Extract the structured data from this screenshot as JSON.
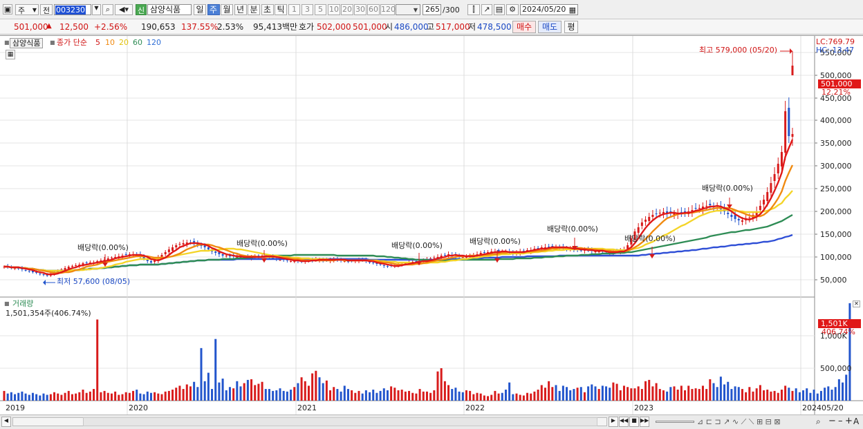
{
  "toolbar": {
    "market_label": "주",
    "prev_label": "전",
    "code": "003230",
    "stock_name": "삼양식품",
    "sin_label": "신",
    "period_buttons": [
      "일",
      "주",
      "월",
      "년",
      "분",
      "초",
      "틱"
    ],
    "interval_buttons": [
      "1",
      "3",
      "5",
      "10",
      "20",
      "30",
      "60",
      "120"
    ],
    "count": "265",
    "count_total": "/300",
    "date": "2024/05/20"
  },
  "quote": {
    "price": "501,000",
    "change": "12,500",
    "change_pct": "+2.56%",
    "volume": "190,653",
    "vol_ratio": "137.55%",
    "turnover": "2.53%",
    "amount": "95,413백만",
    "hoga_label": "호가",
    "ask": "502,000",
    "bid": "501,000",
    "open_label": "시",
    "open": "486,000",
    "high_label": "고",
    "high": "517,000",
    "low_label": "저",
    "low": "478,500",
    "buy_label": "매수",
    "sell_label": "매도",
    "avg_label": "평"
  },
  "colors": {
    "up": "#d81b1b",
    "down": "#2255cc",
    "ma5": "#e01818",
    "ma10": "#f08a10",
    "ma20": "#f4d428",
    "ma60": "#2e8c55",
    "ma120": "#2e4ed6"
  },
  "legend": {
    "name": "삼양식품",
    "prefix": "종가 단순",
    "ma5": "5",
    "ma10": "10",
    "ma20": "20",
    "ma60": "60",
    "ma120": "120"
  },
  "price_axis": {
    "lc": "LC:769.79",
    "hc": "HC:-13.47",
    "current_tag": "501,000",
    "current_pct": "12.21%"
  },
  "volume_panel": {
    "title": "거래량",
    "info": "1,501,354주(406.74%)",
    "tag": "1,501K",
    "tag_pct": "406.74%"
  },
  "annotations": {
    "max": "최고 579,000 (05/20)",
    "min": "최저 57,600 (08/05)",
    "dividend": "배당락(0.00%)"
  },
  "bottom": {
    "date_tag": "05/20"
  },
  "chart_data": {
    "type": "candlestick",
    "x_labels": [
      "2019",
      "2020",
      "2021",
      "2022",
      "2023",
      "2024"
    ],
    "price_ticks": [
      550000,
      500000,
      450000,
      400000,
      350000,
      300000,
      250000,
      200000,
      150000,
      100000,
      50000
    ],
    "price_tick_labels": [
      "550,000",
      "500,000",
      "450,000",
      "400,000",
      "350,000",
      "300,000",
      "250,000",
      "200,000",
      "150,000",
      "100,000",
      "50,000"
    ],
    "volume_ticks": [
      1000000,
      500000
    ],
    "volume_tick_labels": [
      "1,000K",
      "500,000"
    ],
    "close": [
      78000,
      77000,
      76000,
      75000,
      74000,
      72000,
      70000,
      68000,
      66000,
      64000,
      62000,
      60000,
      58500,
      62000,
      66000,
      69000,
      72000,
      75000,
      78000,
      80000,
      81000,
      83000,
      85000,
      86000,
      87000,
      88000,
      90000,
      92000,
      94000,
      96000,
      98000,
      100000,
      101000,
      103000,
      104000,
      105000,
      106000,
      104000,
      100000,
      95000,
      90000,
      87000,
      92000,
      98000,
      104000,
      110000,
      116000,
      121000,
      125000,
      128000,
      130000,
      131000,
      132000,
      130000,
      127000,
      124000,
      120000,
      116000,
      112000,
      108000,
      105000,
      103000,
      102000,
      101000,
      101000,
      100000,
      99000,
      99000,
      98000,
      99000,
      100000,
      101000,
      102000,
      101000,
      100000,
      97000,
      95000,
      94000,
      93000,
      92000,
      91000,
      91000,
      90000,
      90000,
      91000,
      92000,
      93000,
      94000,
      93000,
      92000,
      92000,
      93000,
      94000,
      93000,
      92000,
      91000,
      90000,
      91000,
      92000,
      93000,
      92000,
      90000,
      88000,
      86000,
      84000,
      82000,
      80000,
      79000,
      80000,
      81000,
      82000,
      84000,
      86000,
      88000,
      89000,
      89000,
      90000,
      92000,
      94000,
      96000,
      98000,
      100000,
      102000,
      104000,
      106000,
      104000,
      102000,
      100000,
      99000,
      100000,
      102000,
      104000,
      106000,
      108000,
      109000,
      110000,
      111000,
      112000,
      112000,
      111000,
      110000,
      109000,
      108000,
      109000,
      111000,
      113000,
      114000,
      115000,
      117000,
      119000,
      120000,
      121000,
      122000,
      122000,
      121000,
      120000,
      119000,
      118000,
      117000,
      116000,
      116000,
      115000,
      115000,
      114000,
      113000,
      112000,
      112000,
      111000,
      110000,
      109000,
      110000,
      112000,
      114000,
      116000,
      125000,
      140000,
      155000,
      165000,
      175000,
      182000,
      188000,
      192000,
      195000,
      197000,
      198000,
      196000,
      195000,
      195000,
      196000,
      197000,
      198000,
      200000,
      203000,
      206000,
      208000,
      210000,
      212000,
      214000,
      212000,
      209000,
      205000,
      200000,
      194000,
      188000,
      183000,
      180000,
      180000,
      182000,
      186000,
      192000,
      200000,
      212000,
      226000,
      243000,
      262000,
      282000,
      305000,
      330000,
      420000,
      365000,
      370000
    ],
    "volume": [
      150000,
      110000,
      130000,
      100000,
      120000,
      140000,
      110000,
      90000,
      120000,
      100000,
      80000,
      110000,
      90000,
      100000,
      130000,
      110000,
      90000,
      120000,
      150000,
      100000,
      110000,
      130000,
      170000,
      120000,
      140000,
      180000,
      1250000,
      130000,
      150000,
      120000,
      110000,
      140000,
      90000,
      100000,
      130000,
      120000,
      150000,
      170000,
      110000,
      100000,
      140000,
      120000,
      130000,
      110000,
      100000,
      140000,
      150000,
      170000,
      200000,
      230000,
      180000,
      250000,
      220000,
      290000,
      210000,
      810000,
      300000,
      430000,
      180000,
      950000,
      280000,
      340000,
      160000,
      210000,
      190000,
      300000,
      220000,
      270000,
      320000,
      330000,
      240000,
      260000,
      290000,
      180000,
      180000,
      150000,
      160000,
      190000,
      150000,
      140000,
      170000,
      210000,
      270000,
      360000,
      300000,
      230000,
      420000,
      460000,
      360000,
      270000,
      310000,
      160000,
      210000,
      180000,
      140000,
      230000,
      180000,
      160000,
      120000,
      150000,
      110000,
      160000,
      130000,
      170000,
      120000,
      150000,
      190000,
      160000,
      220000,
      200000,
      160000,
      170000,
      140000,
      150000,
      120000,
      110000,
      180000,
      140000,
      140000,
      120000,
      160000,
      450000,
      500000,
      300000,
      240000,
      180000,
      200000,
      140000,
      130000,
      160000,
      150000,
      100000,
      120000,
      110000,
      80000,
      70000,
      90000,
      150000,
      110000,
      120000,
      170000,
      280000,
      100000,
      110000,
      90000,
      80000,
      120000,
      110000,
      140000,
      170000,
      240000,
      200000,
      300000,
      210000,
      240000,
      150000,
      230000,
      210000,
      160000,
      180000,
      200000,
      210000,
      130000,
      220000,
      250000,
      220000,
      180000,
      230000,
      220000,
      200000,
      280000,
      260000,
      160000,
      230000,
      210000,
      190000,
      190000,
      220000,
      180000,
      300000,
      320000,
      220000,
      270000,
      180000,
      160000,
      140000,
      210000,
      220000,
      170000,
      230000,
      160000,
      230000,
      180000,
      190000,
      180000,
      230000,
      180000,
      330000,
      270000,
      210000,
      370000,
      250000,
      290000,
      180000,
      220000,
      210000,
      180000,
      130000,
      210000,
      140000,
      190000,
      240000,
      160000,
      170000,
      140000,
      150000,
      120000,
      170000,
      230000,
      200000,
      150000,
      190000,
      130000,
      160000,
      190000,
      120000,
      170000,
      110000,
      150000,
      200000,
      220000,
      170000,
      210000,
      330000,
      280000,
      400000,
      1501354
    ]
  }
}
